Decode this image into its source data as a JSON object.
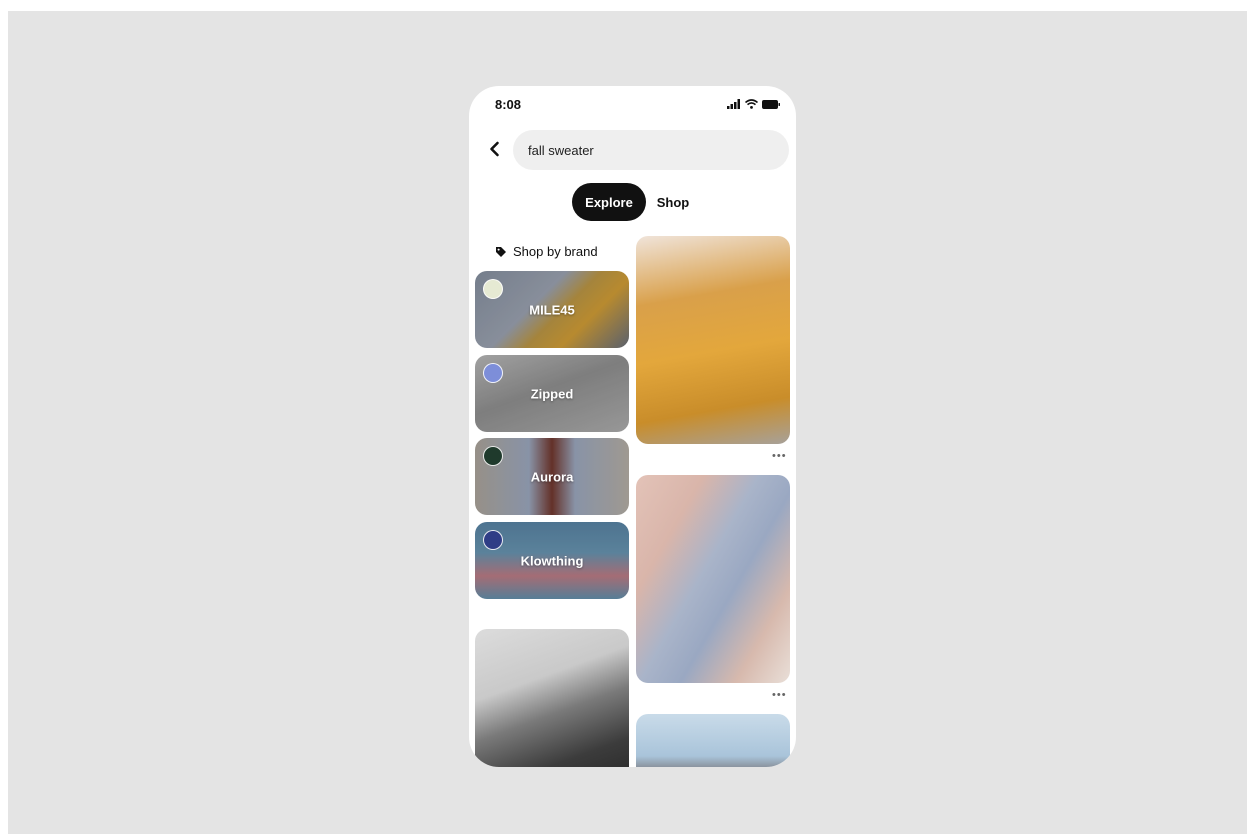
{
  "status_bar": {
    "time": "8:08"
  },
  "search": {
    "query": "fall sweater"
  },
  "tabs": [
    {
      "label": "Explore",
      "active": true
    },
    {
      "label": "Shop",
      "active": false
    }
  ],
  "brands": {
    "header": "Shop by brand",
    "items": [
      {
        "name": "MILE45"
      },
      {
        "name": "Zipped"
      },
      {
        "name": "Aurora"
      },
      {
        "name": "Klowthing"
      }
    ]
  },
  "pins": {
    "more_label": "•••"
  },
  "colors": {
    "background": "#e4e4e4",
    "active_tab": "#111111",
    "search_bg": "#efefef"
  }
}
